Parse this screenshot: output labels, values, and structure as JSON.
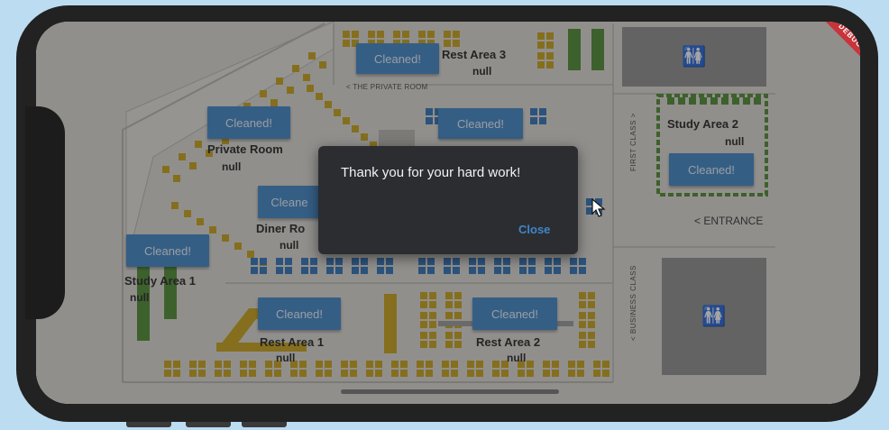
{
  "dialog": {
    "message": "Thank you for your hard work!",
    "close_label": "Close"
  },
  "debug_banner": "DEBUG",
  "zones": [
    {
      "id": "rest-area-3",
      "name": "Rest Area 3",
      "status": "null",
      "button": "Cleaned!"
    },
    {
      "id": "private-room",
      "name": "Private Room",
      "status": "null",
      "button": "Cleaned!"
    },
    {
      "id": "center-top",
      "name": "",
      "status": "",
      "button": "Cleaned!"
    },
    {
      "id": "study-area-2",
      "name": "Study Area 2",
      "status": "null",
      "button": "Cleaned!"
    },
    {
      "id": "dinner-room",
      "name": "Diner Ro",
      "status": "null",
      "button": "Cleane"
    },
    {
      "id": "study-area-1",
      "name": "Study Area 1",
      "status": "null",
      "button": "Cleaned!"
    },
    {
      "id": "rest-area-1",
      "name": "Rest Area 1",
      "status": "null",
      "button": "Cleaned!"
    },
    {
      "id": "rest-area-2",
      "name": "Rest Area 2",
      "status": "null",
      "button": "Cleaned!"
    }
  ],
  "map_captions": {
    "private_room": "< THE PRIVATE ROOM",
    "entrance": "< ENTRANCE",
    "first_class": "FIRST CLASS >",
    "business_class": "< BUSINESS CLASS"
  },
  "restroom_icon": "restroom-icon",
  "colors": {
    "button_blue": "#3f86c8",
    "seat_yellow": "#c8a218",
    "seat_blue": "#2f73b8",
    "seat_green": "#4d8a2f",
    "dialog_bg": "#2b2d31",
    "debug_red": "#c9343b"
  }
}
